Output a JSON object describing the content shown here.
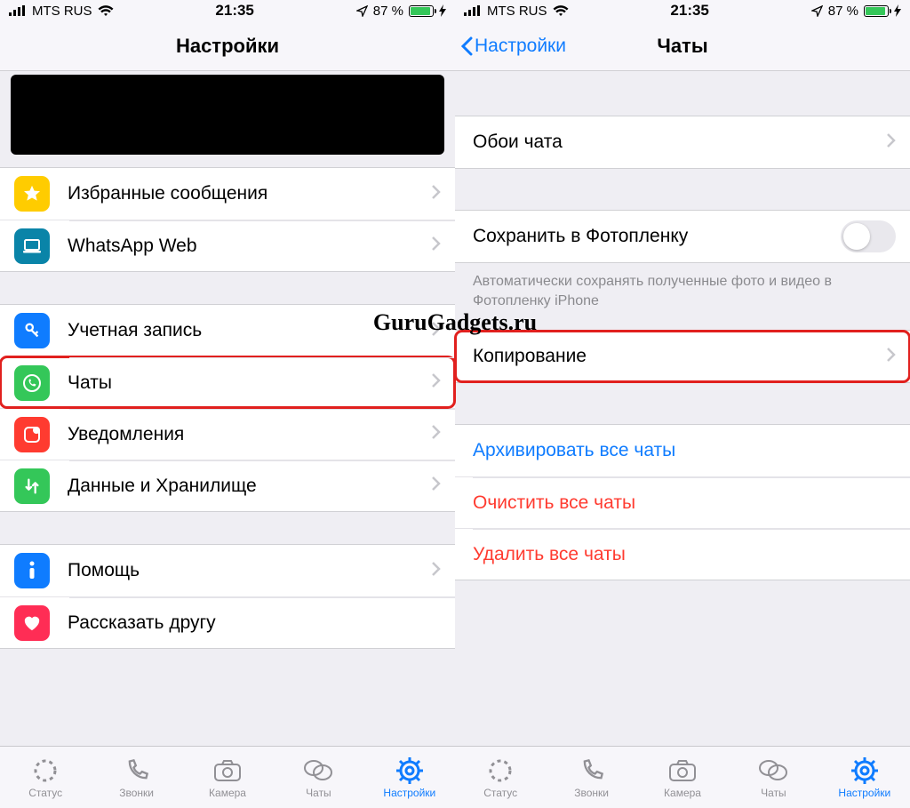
{
  "watermark": "GuruGadgets.ru",
  "status": {
    "carrier": "MTS RUS",
    "time": "21:35",
    "battery_pct": "87 %"
  },
  "left": {
    "title": "Настройки",
    "groups": {
      "g1": {
        "starred": "Избранные сообщения",
        "web": "WhatsApp Web"
      },
      "g2": {
        "account": "Учетная запись",
        "chats": "Чаты",
        "notifications": "Уведомления",
        "storage": "Данные и Хранилище"
      },
      "g3": {
        "help": "Помощь",
        "tell": "Рассказать другу"
      }
    }
  },
  "right": {
    "back": "Настройки",
    "title": "Чаты",
    "rows": {
      "wallpaper": "Обои чата",
      "save_roll": "Сохранить в Фотопленку",
      "save_note": "Автоматически сохранять полученные фото и видео в Фотопленку iPhone",
      "backup": "Копирование",
      "archive": "Архивировать все чаты",
      "clear": "Очистить все чаты",
      "delete": "Удалить все чаты"
    }
  },
  "tabs": {
    "status": "Статус",
    "calls": "Звонки",
    "camera": "Камера",
    "chats": "Чаты",
    "settings": "Настройки"
  }
}
